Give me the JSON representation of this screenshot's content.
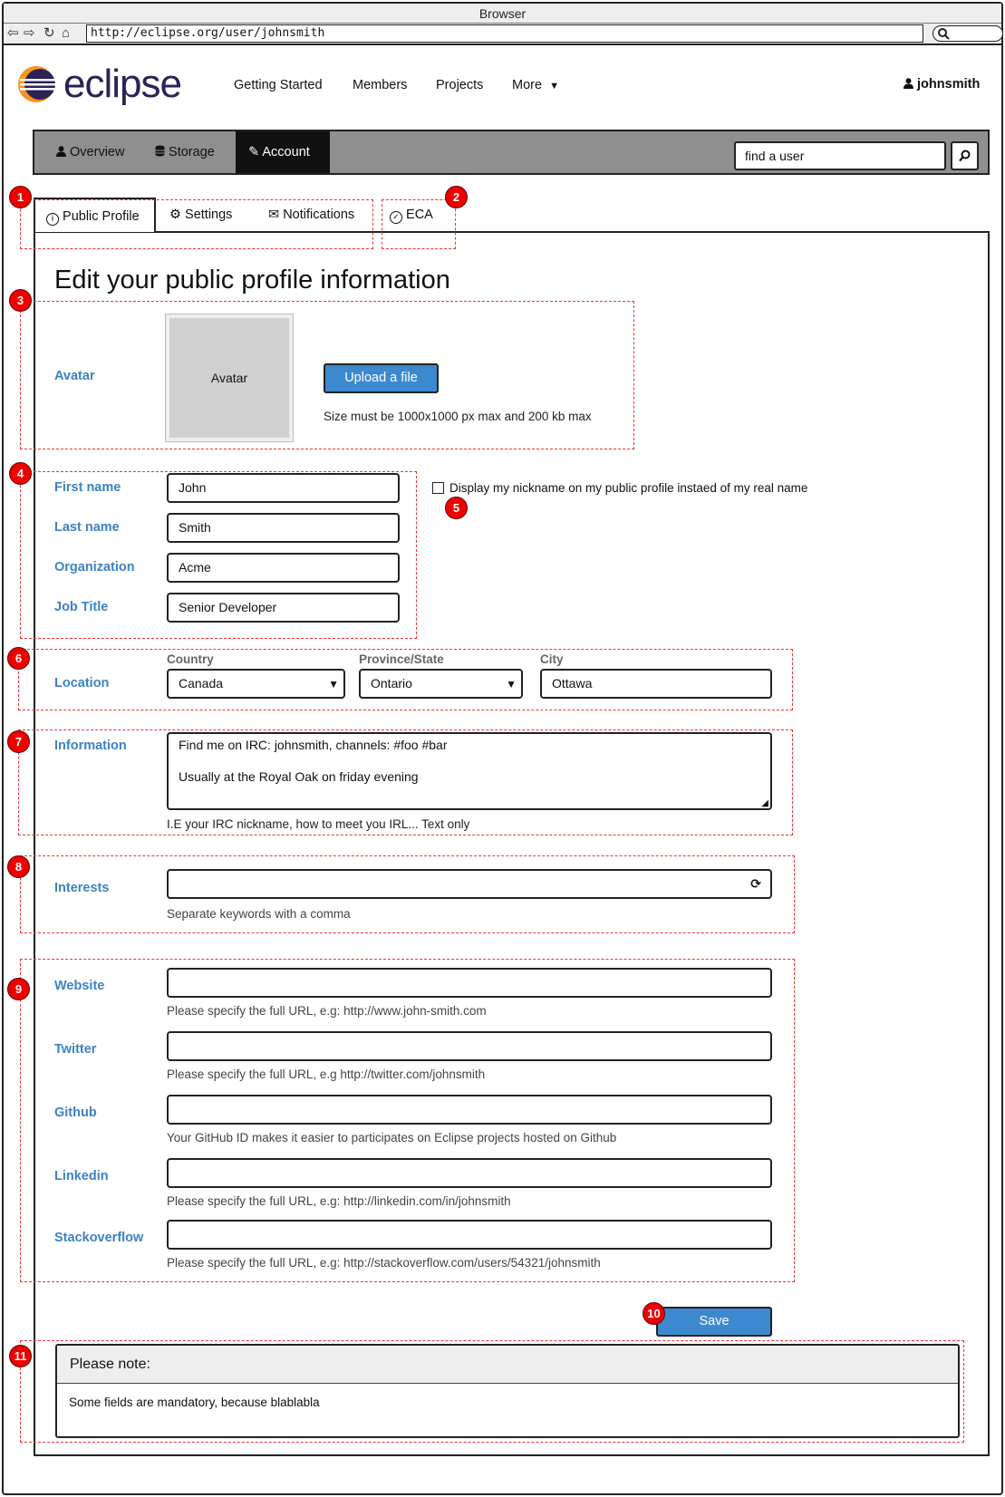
{
  "browser": {
    "title": "Browser",
    "url": "http://eclipse.org/user/johnsmith",
    "nav_icons": [
      "back-icon",
      "forward-icon",
      "reload-icon",
      "home-icon"
    ]
  },
  "site": {
    "logo_text": "eclipse",
    "nav": [
      "Getting Started",
      "Members",
      "Projects",
      "More"
    ],
    "username": "johnsmith"
  },
  "account_bar": {
    "tabs": [
      {
        "label": "Overview",
        "icon": "user-icon"
      },
      {
        "label": "Storage",
        "icon": "database-icon"
      },
      {
        "label": "Account",
        "icon": "pencil-icon",
        "active": true
      }
    ],
    "search_value": "find a user"
  },
  "subtabs": [
    {
      "label": "Public Profile",
      "icon": "info-icon",
      "active": true
    },
    {
      "label": "Settings",
      "icon": "gear-icon"
    },
    {
      "label": "Notifications",
      "icon": "envelope-icon"
    },
    {
      "label": "ECA",
      "icon": "check-circle-icon"
    }
  ],
  "annotations": [
    "1",
    "2",
    "3",
    "4",
    "5",
    "6",
    "7",
    "8",
    "9",
    "10",
    "11"
  ],
  "form": {
    "title": "Edit your public profile information",
    "avatar": {
      "label": "Avatar",
      "placeholder": "Avatar",
      "upload_label": "Upload a file",
      "hint": "Size must be 1000x1000 px max and 200 kb max"
    },
    "names": [
      {
        "label": "First name",
        "value": "John"
      },
      {
        "label": "Last name",
        "value": "Smith"
      },
      {
        "label": "Organization",
        "value": "Acme"
      },
      {
        "label": "Job Title",
        "value": "Senior Developer"
      }
    ],
    "nickname_checkbox": {
      "label": "Display my nickname on my public profile instaed of my real name",
      "checked": false
    },
    "location": {
      "label": "Location",
      "country_label": "Country",
      "country": "Canada",
      "province_label": "Province/State",
      "province": "Ontario",
      "city_label": "City",
      "city": "Ottawa"
    },
    "information": {
      "label": "Information",
      "line1": "Find me on IRC: johnsmith, channels: #foo #bar",
      "line2": "Usually at the Royal Oak on friday evening",
      "hint": "I.E your IRC nickname, how to meet you IRL... Text only"
    },
    "interests": {
      "label": "Interests",
      "value": "",
      "hint": "Separate keywords with a comma"
    },
    "links": [
      {
        "label": "Website",
        "value": "",
        "hint": "Please specify the full URL, e.g: http://www.john-smith.com"
      },
      {
        "label": "Twitter",
        "value": "",
        "hint": "Please specify the full URL, e.g http://twitter.com/johnsmith"
      },
      {
        "label": "Github",
        "value": "",
        "hint": "Your GitHub ID makes it easier to participates on Eclipse projects hosted on Github"
      },
      {
        "label": "Linkedin",
        "value": "",
        "hint": "Please specify the full URL, e.g: http://linkedin.com/in/johnsmith"
      },
      {
        "label": "Stackoverflow",
        "value": "",
        "hint": "Please specify the full URL, e.g: http://stackoverflow.com/users/54321/johnsmith"
      }
    ],
    "save_label": "Save"
  },
  "note": {
    "title": "Please note:",
    "body": "Some fields are mandatory, because blablabla"
  },
  "colors": {
    "label_blue": "#3d82c4",
    "button_blue": "#3d89d0",
    "annotation_red": "#e00000"
  }
}
